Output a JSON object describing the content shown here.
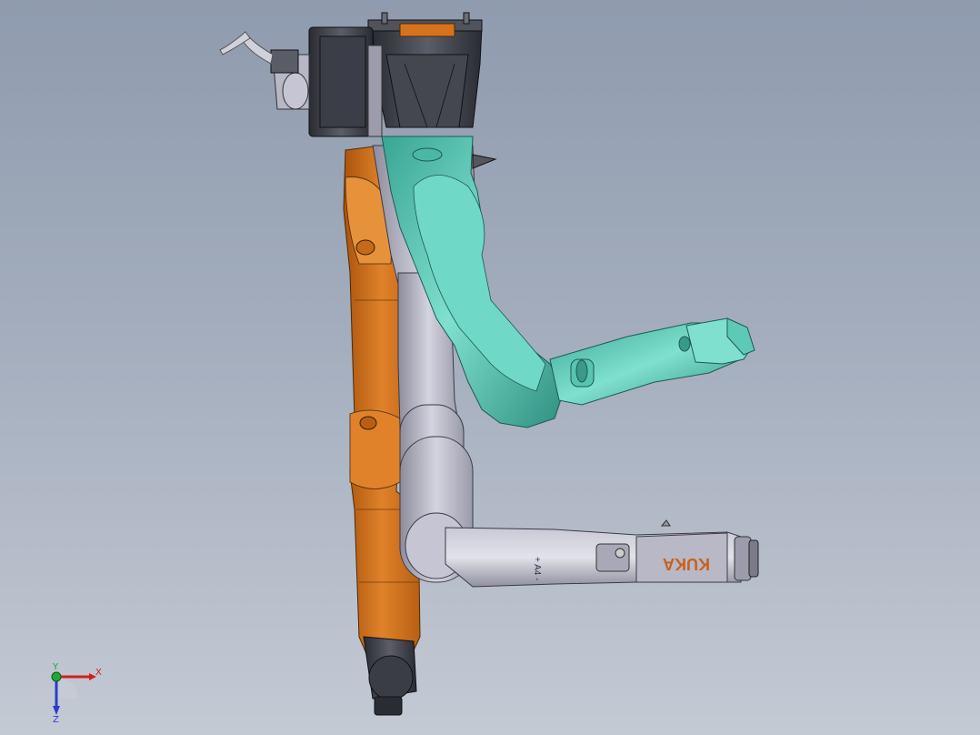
{
  "model": {
    "brand_label": "KUKA",
    "joint_marking": "+ A4 -"
  },
  "triad": {
    "x_label": "X",
    "y_label": "Y",
    "z_label": "Z"
  },
  "colors": {
    "background_top": "#8f9bae",
    "background_bottom": "#c4cad4",
    "orange_arm": "#d4731c",
    "grey_arm": "#b9b9c9",
    "teal_arm": "#5ec9b7",
    "dark_parts": "#3a3c44",
    "x_axis": "#d11f1f",
    "y_axis": "#1fa83a",
    "z_axis": "#2a3ccf"
  }
}
